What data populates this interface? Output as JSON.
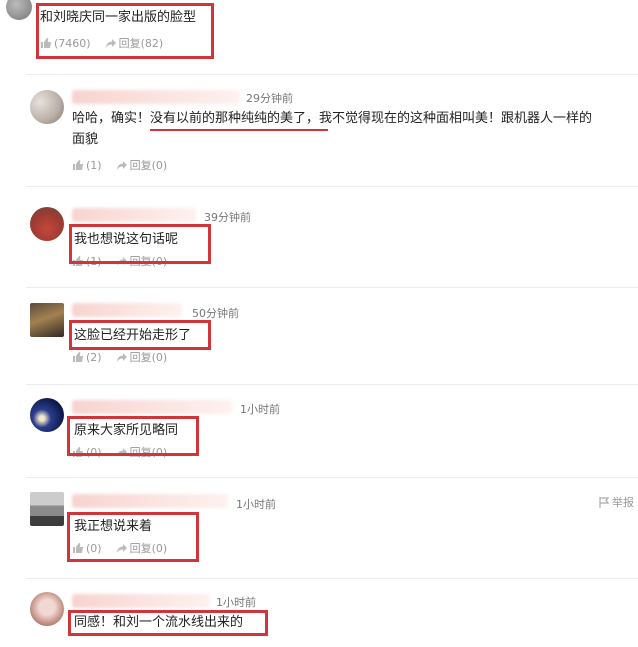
{
  "comments": [
    {
      "text": "和刘晓庆同一家出版的脸型",
      "likes": "(7460)",
      "reply": "回复(82)",
      "time": ""
    },
    {
      "time": "29分钟前",
      "text_pre": "哈哈，确实！",
      "text_mark": "没有以前的那种纯纯的美了",
      "text_post": "，我不觉得现在的这种面相叫美！跟机器人一样的",
      "text_line2": "面貌",
      "likes": "(1)",
      "reply": "回复(0)"
    },
    {
      "time": "39分钟前",
      "text": "我也想说这句话呢",
      "likes": "(1)",
      "reply": "回复(0)"
    },
    {
      "time": "50分钟前",
      "text": "这脸已经开始走形了",
      "likes": "(2)",
      "reply": "回复(0)"
    },
    {
      "time": "1小时前",
      "text": "原来大家所见略同",
      "likes": "(0)",
      "reply": "回复(0)"
    },
    {
      "time": "1小时前",
      "text": "我正想说来着",
      "likes": "(0)",
      "reply": "回复(0)",
      "report": "举报"
    },
    {
      "time": "1小时前",
      "text": "同感！和刘一个流水线出来的"
    }
  ],
  "icons": {
    "like": "thumbs-up-icon",
    "reply": "reply-arrow-icon",
    "report": "flag-icon"
  },
  "colors": {
    "highlight": "#d0353b",
    "muted": "#999999",
    "blur": "#f7d3cf"
  }
}
